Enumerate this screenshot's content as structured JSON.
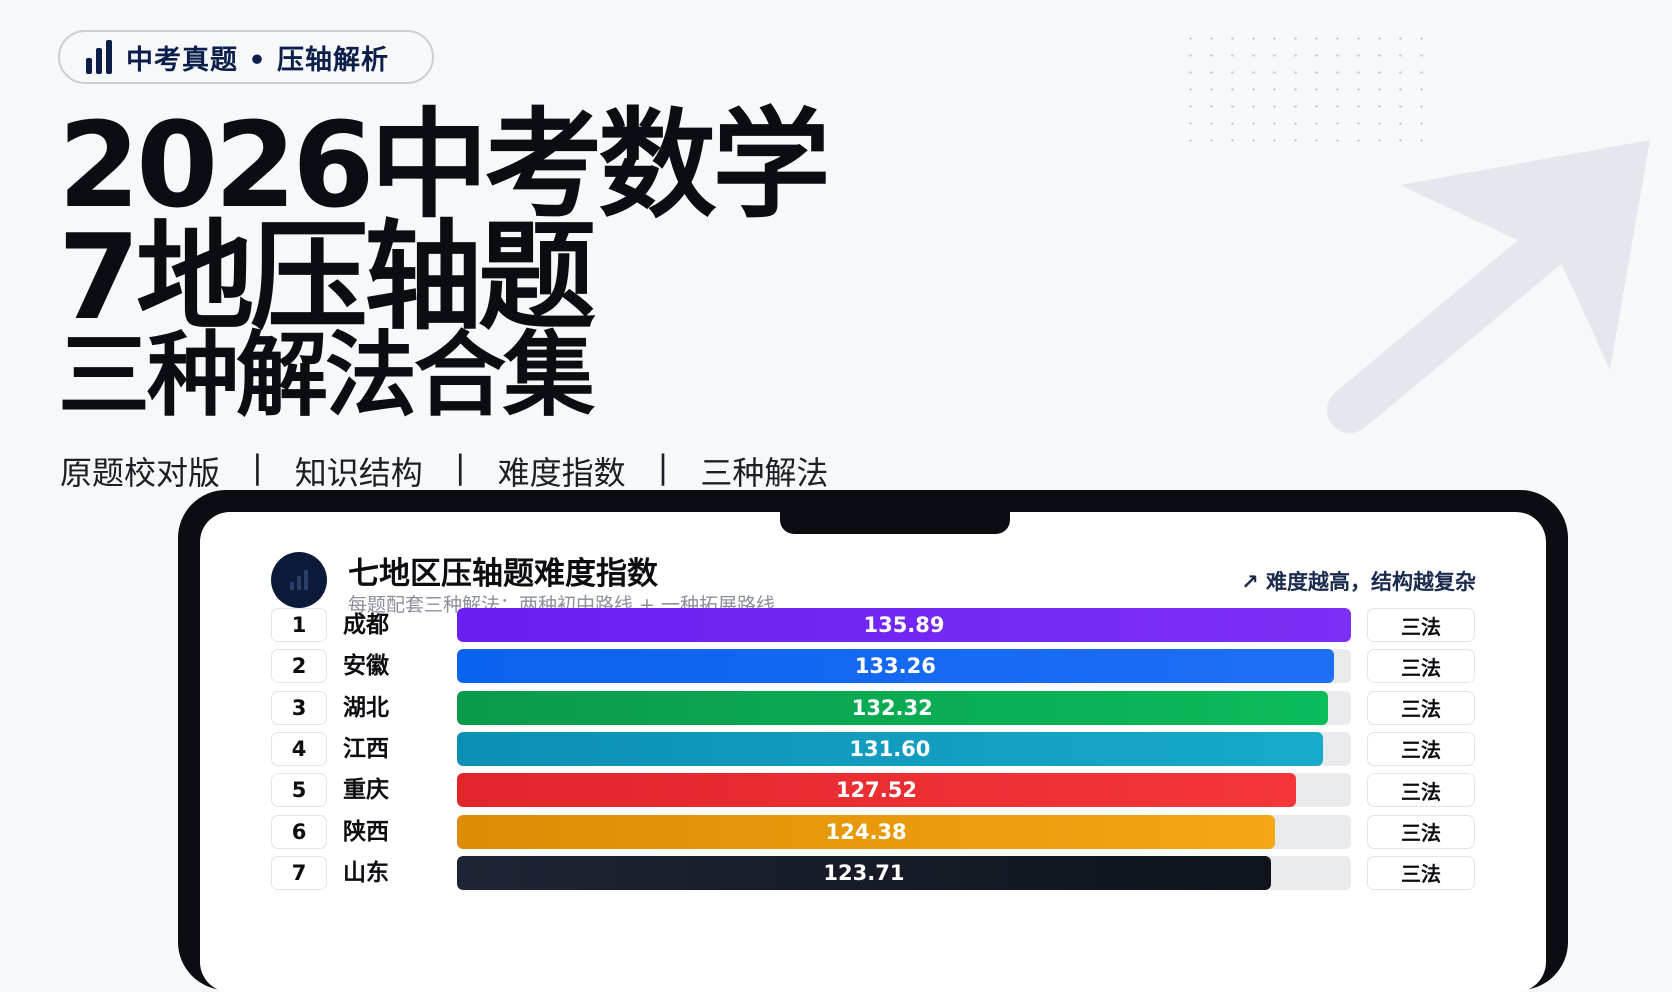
{
  "badge": {
    "text": "中考真题 • 压轴解析"
  },
  "hero": {
    "line1": "2026中考数学",
    "line2": "7地压轴题",
    "line3": "三种解法合集"
  },
  "features": [
    "原题校对版",
    "知识结构",
    "难度指数",
    "三种解法"
  ],
  "features_separator": "|",
  "chart_header": {
    "title": "七地区压轴题难度指数",
    "subtitle": "每题配套三种解法：两种初中路线 + 一种拓展路线",
    "note": "↗ 难度越高，结构越复杂"
  },
  "colors": {
    "bars": [
      [
        "#6a1ff0",
        "#7b2ff7"
      ],
      [
        "#0a62f0",
        "#1f6ff5"
      ],
      [
        "#0a9a4a",
        "#0bbb5c"
      ],
      [
        "#0b8fb5",
        "#18aacb"
      ],
      [
        "#e0262b",
        "#f4363a"
      ],
      [
        "#dc8c05",
        "#f3a712"
      ],
      [
        "#1e2433",
        "#0f131c"
      ]
    ]
  },
  "chart_data": {
    "type": "bar",
    "title": "七地区压轴题难度指数",
    "categories": [
      "成都",
      "安徽",
      "湖北",
      "江西",
      "重庆",
      "陕西",
      "山东"
    ],
    "ranks": [
      "1",
      "2",
      "3",
      "4",
      "5",
      "6",
      "7"
    ],
    "values": [
      135.89,
      133.26,
      132.32,
      131.6,
      127.52,
      124.38,
      123.71
    ],
    "value_labels": [
      "135.89",
      "133.26",
      "132.32",
      "131.60",
      "127.52",
      "124.38",
      "123.71"
    ],
    "methods": [
      "三法",
      "三法",
      "三法",
      "三法",
      "三法",
      "三法",
      "三法"
    ],
    "orientation": "horizontal",
    "grid": false
  }
}
